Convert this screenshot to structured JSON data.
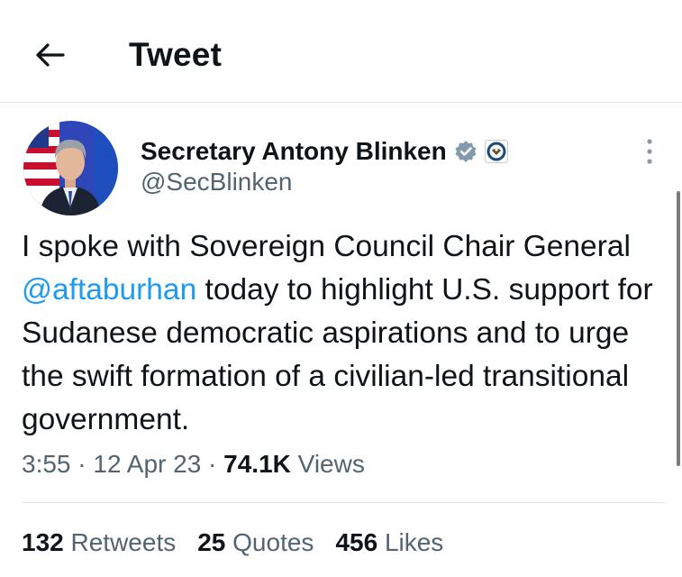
{
  "header": {
    "title": "Tweet",
    "back_icon": "arrow-left-icon"
  },
  "author": {
    "display_name": "Secretary Antony Blinken",
    "handle": "@SecBlinken",
    "verified_color": "#829aab",
    "affiliation_icon": "state-department-seal-icon"
  },
  "tweet": {
    "text_part1": "I spoke with Sovereign Council Chair General ",
    "mention": "@aftaburhan",
    "text_part2": " today to highlight U.S. support for Sudanese democratic aspirations and to urge the swift formation of a civilian-led transitional government."
  },
  "meta": {
    "time": "3:55",
    "date": "12 Apr 23",
    "views_count": "74.1K",
    "views_label": "Views"
  },
  "stats": [
    {
      "count": "132",
      "label": "Retweets"
    },
    {
      "count": "25",
      "label": "Quotes"
    },
    {
      "count": "456",
      "label": "Likes"
    }
  ],
  "colors": {
    "accent": "#1d9bf0",
    "secondary_text": "#536471",
    "primary_text": "#0f1419"
  }
}
